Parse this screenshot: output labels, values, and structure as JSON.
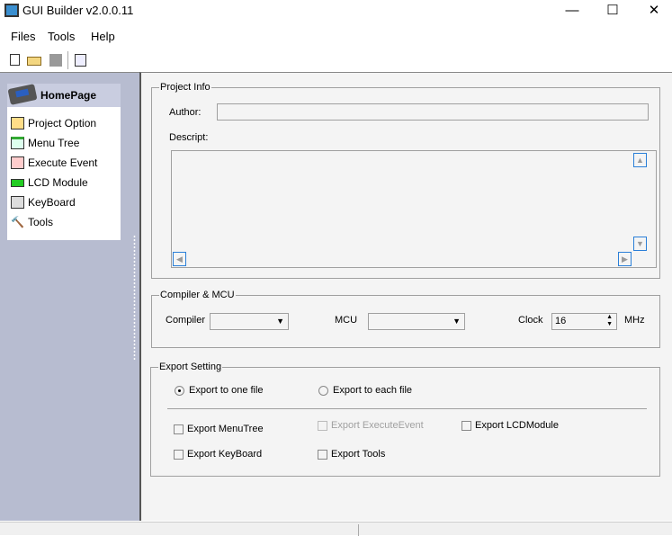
{
  "window": {
    "title": "GUI Builder v2.0.0.11",
    "minimize": "—",
    "maximize": "☐",
    "close": "✕"
  },
  "menu": [
    {
      "label": "Files"
    },
    {
      "label": "Tools"
    },
    {
      "label": "Help"
    }
  ],
  "sidebar": {
    "header": "HomePage",
    "items": [
      {
        "label": "Project Option",
        "icon": "project-option-icon"
      },
      {
        "label": "Menu Tree",
        "icon": "menu-tree-icon"
      },
      {
        "label": "Execute Event",
        "icon": "execute-event-icon"
      },
      {
        "label": "LCD Module",
        "icon": "lcd-module-icon"
      },
      {
        "label": "KeyBoard",
        "icon": "keyboard-icon"
      },
      {
        "label": "Tools",
        "icon": "hammer-icon"
      }
    ]
  },
  "project_info": {
    "legend": "Project Info",
    "author_label": "Author:",
    "author_value": "",
    "descript_label": "Descript:",
    "descript_value": ""
  },
  "compiler": {
    "legend": "Compiler & MCU",
    "compiler_label": "Compiler",
    "compiler_value": "",
    "mcu_label": "MCU",
    "mcu_value": "",
    "clock_label": "Clock",
    "clock_value": "16",
    "clock_unit": "MHz"
  },
  "export": {
    "legend": "Export Setting",
    "radio_one": "Export to one file",
    "radio_each": "Export to each file",
    "selected": "one",
    "menutree": "Export MenuTree",
    "executeevent": "Export ExecuteEvent",
    "lcdmodule": "Export LCDModule",
    "keyboard": "Export KeyBoard",
    "tools": "Export Tools"
  }
}
